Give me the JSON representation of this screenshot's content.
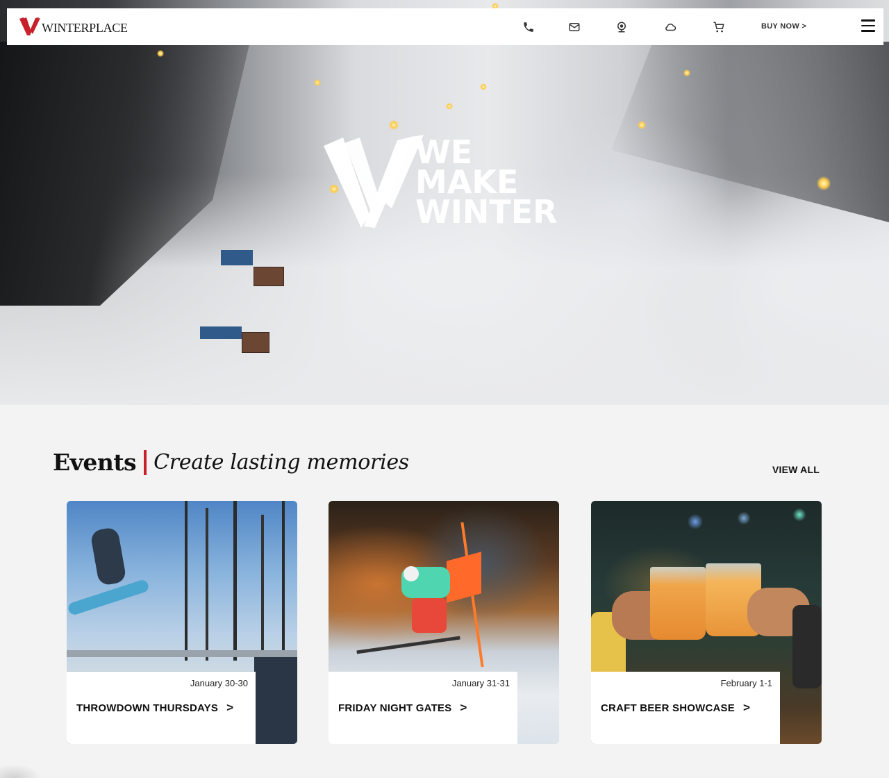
{
  "brand": {
    "name": "WINTERPLACE",
    "accent": "#c8202a"
  },
  "hero": {
    "tagline": [
      "WE",
      "MAKE",
      "WINTER"
    ]
  },
  "nav": {
    "icons": [
      "phone-icon",
      "mail-icon",
      "webcam-icon",
      "weather-cloud-icon",
      "cart-icon"
    ],
    "buy_now": "BUY NOW >",
    "menu_icon": "hamburger-icon"
  },
  "events": {
    "title": "Events",
    "subtitle": "Create lasting memories",
    "view_all": "VIEW ALL",
    "cards": [
      {
        "date": "January 30-30",
        "name": "THROWDOWN THURSDAYS",
        "arrow": ">"
      },
      {
        "date": "January 31-31",
        "name": "FRIDAY NIGHT GATES",
        "arrow": ">"
      },
      {
        "date": "February 1-1",
        "name": "CRAFT BEER SHOWCASE",
        "arrow": ">"
      }
    ]
  }
}
